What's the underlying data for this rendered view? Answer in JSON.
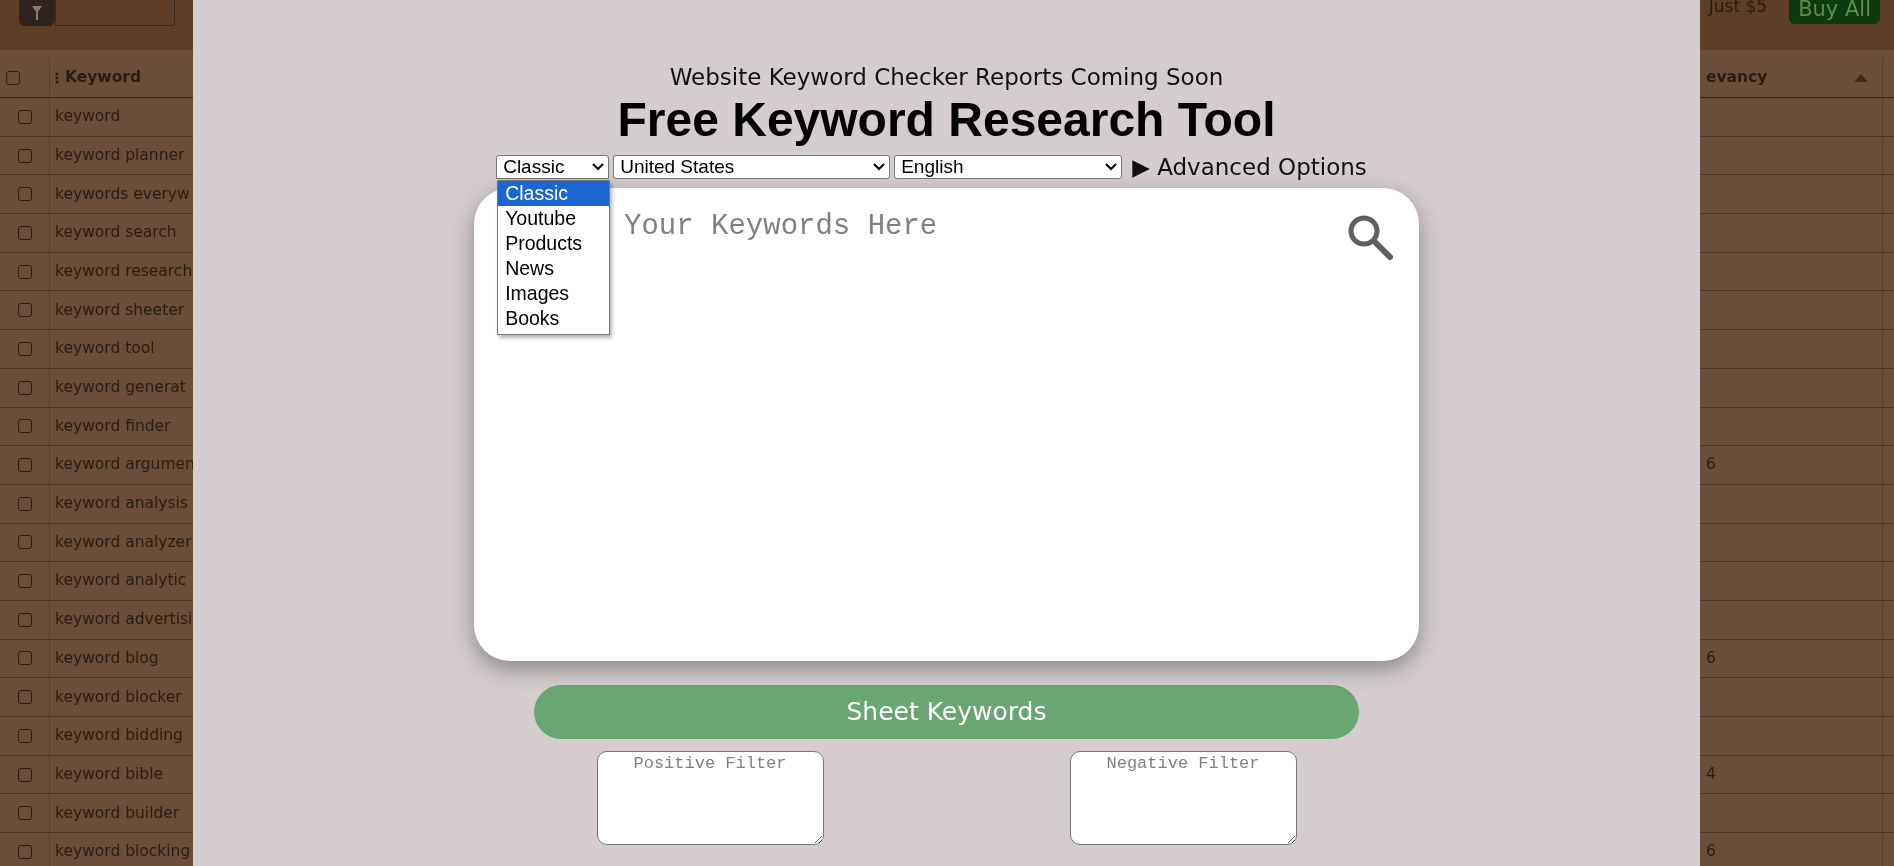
{
  "background_page": {
    "toolbar": {
      "price_text": "Just $5",
      "buy_button": "Buy All"
    },
    "table": {
      "select_all_checked": false,
      "columns": [
        {
          "label": "Keyword",
          "kind": "menu"
        },
        {
          "label": "evancy",
          "kind": "sort",
          "sort_ascending": true
        }
      ],
      "rows": [
        {
          "keyword": "keyword",
          "checked": false
        },
        {
          "keyword": "keyword planner",
          "checked": false
        },
        {
          "keyword": "keywords everyw",
          "checked": false
        },
        {
          "keyword": "keyword search",
          "checked": false
        },
        {
          "keyword": "keyword research",
          "checked": false
        },
        {
          "keyword": "keyword sheeter",
          "checked": false
        },
        {
          "keyword": "keyword tool",
          "checked": false
        },
        {
          "keyword": "keyword generat",
          "checked": false
        },
        {
          "keyword": "keyword finder",
          "checked": false
        },
        {
          "keyword": "keyword argumen",
          "relevancy": "6",
          "checked": false
        },
        {
          "keyword": "keyword analysis",
          "checked": false
        },
        {
          "keyword": "keyword analyzer",
          "checked": false
        },
        {
          "keyword": "keyword analytic",
          "checked": false
        },
        {
          "keyword": "keyword advertisi",
          "checked": false
        },
        {
          "keyword": "keyword blog",
          "relevancy": "6",
          "checked": false
        },
        {
          "keyword": "keyword blocker",
          "checked": false
        },
        {
          "keyword": "keyword bidding",
          "checked": false
        },
        {
          "keyword": "keyword bible",
          "relevancy": "4",
          "checked": false
        },
        {
          "keyword": "keyword builder",
          "checked": false
        },
        {
          "keyword": "keyword blocking",
          "relevancy": "6",
          "checked": false
        }
      ]
    }
  },
  "modal": {
    "notice": "Website Keyword Checker Reports Coming Soon",
    "title": "Free Keyword Research Tool",
    "mode_select": {
      "value": "Classic",
      "expanded": true,
      "options": [
        {
          "label": "Classic",
          "selected": true
        },
        {
          "label": "Youtube",
          "selected": false
        },
        {
          "label": "Products",
          "selected": false
        },
        {
          "label": "News",
          "selected": false
        },
        {
          "label": "Images",
          "selected": false
        },
        {
          "label": "Books",
          "selected": false
        }
      ]
    },
    "country_select": {
      "value": "United States"
    },
    "language_select": {
      "value": "English"
    },
    "advanced_toggle": {
      "marker": "▶",
      "label": "Advanced Options"
    },
    "keywords_input": {
      "placeholder": "Your Keywords Here"
    },
    "submit_button": "Sheet Keywords",
    "filters": [
      {
        "placeholder": "Positive Filter"
      },
      {
        "placeholder": "Negative Filter"
      }
    ]
  }
}
